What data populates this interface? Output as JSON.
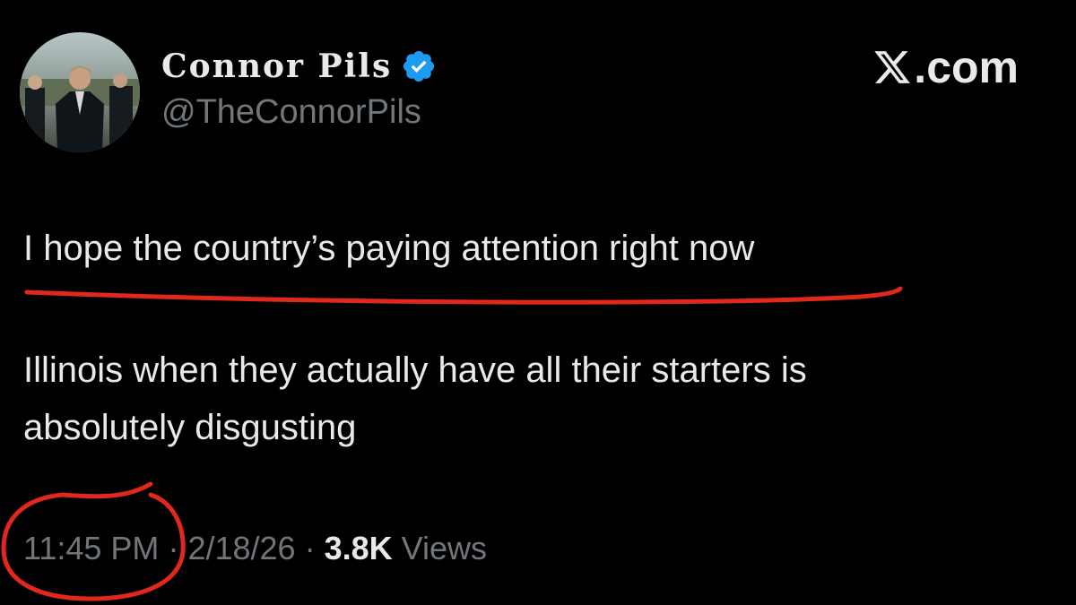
{
  "tweet": {
    "author": {
      "display_name": "Connor Pils",
      "handle": "@TheConnorPils",
      "verified": true,
      "avatar_icon": "profile-photo"
    },
    "source": {
      "domain": ".com",
      "logo_icon": "x-logo-icon"
    },
    "text_lines": [
      "I hope the country’s paying attention right now",
      "Illinois when they actually have all their starters is",
      "absolutely disgusting"
    ],
    "meta": {
      "time": "11:45 PM",
      "separator": "·",
      "date": "2/18/26",
      "views_count": "3.8K",
      "views_label": "Views"
    }
  },
  "colors": {
    "background": "#000000",
    "primary_text": "#e7e9ea",
    "secondary_text": "#71767b",
    "verified_badge": "#1d9bf0",
    "annotation_red": "#e0281c"
  }
}
